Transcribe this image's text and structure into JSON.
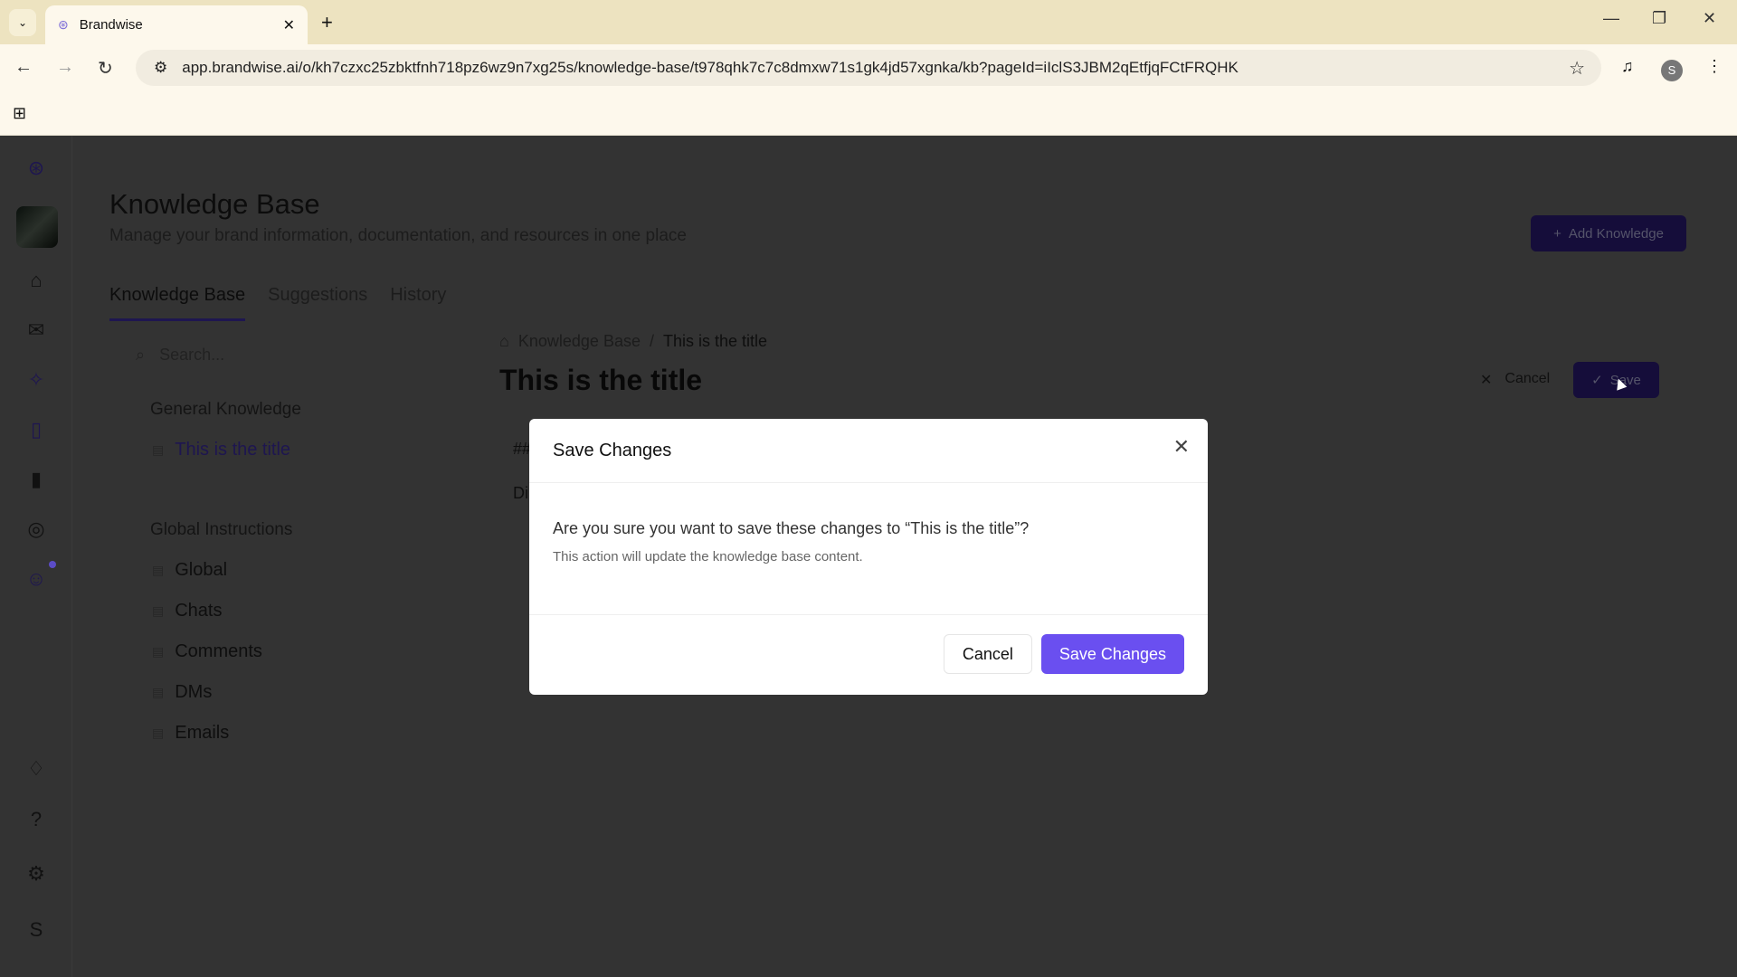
{
  "browser": {
    "tab_title": "Brandwise",
    "url": "app.brandwise.ai/o/kh7czxc25zbktfnh718pz6wz9n7xg25s/knowledge-base/t978qhk7c7c8dmxw71s1gk4jd57xgnka/kb?pageId=iIclS3JBM2qEtfjqFCtFRQHK",
    "profile_initial": "S"
  },
  "header": {
    "title": "Knowledge Base",
    "subtitle": "Manage your brand information, documentation, and resources in one place",
    "add_button": "Add Knowledge"
  },
  "tabs": [
    {
      "label": "Knowledge Base"
    },
    {
      "label": "Suggestions"
    },
    {
      "label": "History"
    }
  ],
  "search": {
    "placeholder": "Search..."
  },
  "tree": {
    "group1": "General Knowledge",
    "group1_items": [
      "This is the title"
    ],
    "group2": "Global Instructions",
    "group2_items": [
      "Global",
      "Chats",
      "Comments",
      "DMs",
      "Emails"
    ]
  },
  "editor": {
    "breadcrumb_root": "Knowledge Base",
    "breadcrumb_current": "This is the title",
    "title": "This is the title",
    "cancel": "Cancel",
    "save": "Save",
    "snippet1": "##",
    "snippet2": "Di"
  },
  "sidebar": {
    "user_initial": "S"
  },
  "modal": {
    "title": "Save Changes",
    "question": "Are you sure you want to save these changes to “This is the title”?",
    "note": "This action will update the knowledge base content.",
    "cancel": "Cancel",
    "confirm": "Save Changes"
  },
  "colors": {
    "accent": "#6a4ff0"
  }
}
